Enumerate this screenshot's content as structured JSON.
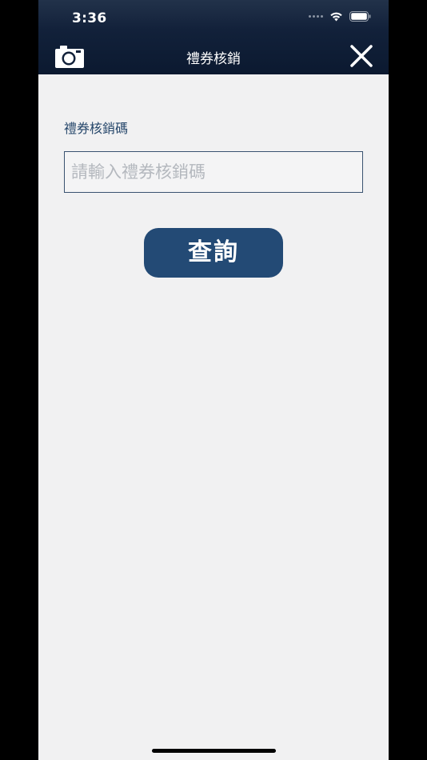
{
  "status_bar": {
    "time": "3:36"
  },
  "nav": {
    "title": "禮券核銷",
    "left_icon": "camera-icon",
    "right_icon": "close-icon"
  },
  "form": {
    "label": "禮券核銷碼",
    "input_value": "",
    "input_placeholder": "請輸入禮券核銷碼",
    "submit_label": "查詢"
  },
  "colors": {
    "navbar": "#12213a",
    "accent": "#234a75",
    "label_text": "#26476b",
    "background": "#f1f1f2"
  }
}
